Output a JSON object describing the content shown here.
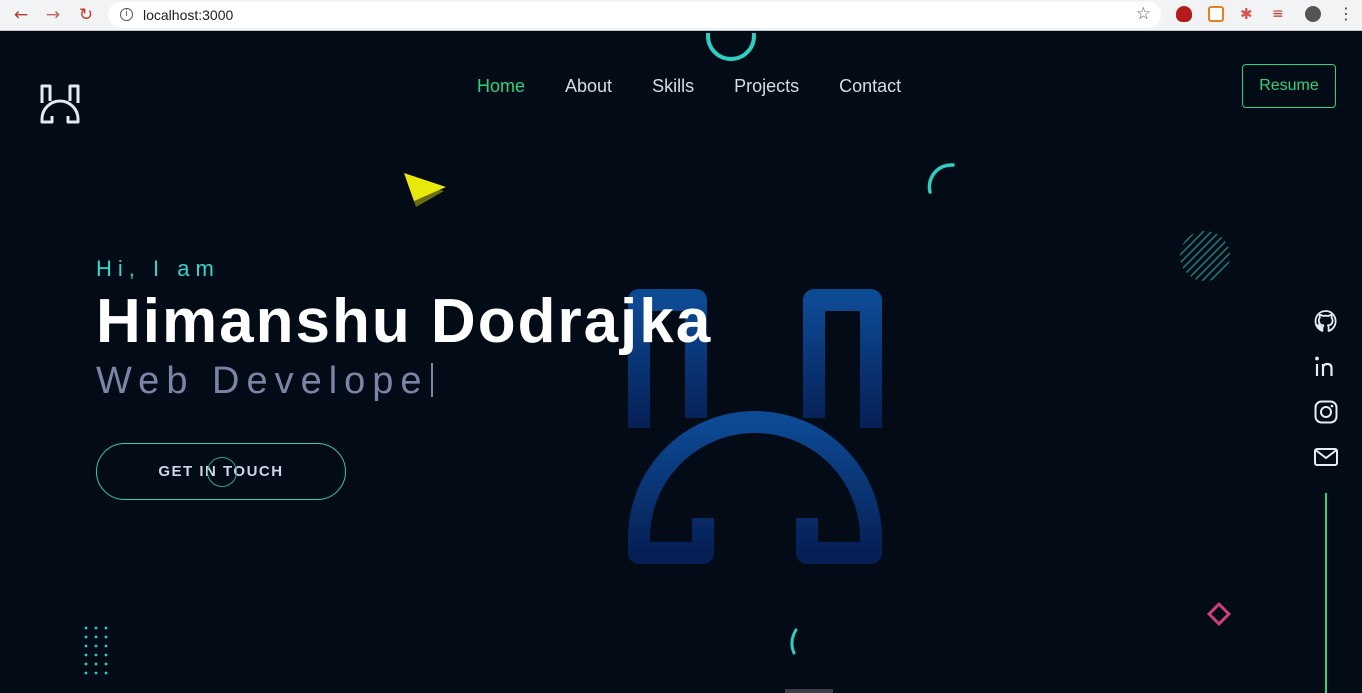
{
  "browser": {
    "url": "localhost:3000",
    "back_icon": "arrow-left-icon",
    "forward_icon": "arrow-right-icon",
    "reload_icon": "reload-icon",
    "bookmark_icon": "star-icon",
    "menu_icon": "kebab-menu-icon"
  },
  "nav": {
    "items": [
      {
        "label": "Home",
        "active": true
      },
      {
        "label": "About",
        "active": false
      },
      {
        "label": "Skills",
        "active": false
      },
      {
        "label": "Projects",
        "active": false
      },
      {
        "label": "Contact",
        "active": false
      }
    ],
    "resume_label": "Resume"
  },
  "hero": {
    "greeting": "Hi, I am",
    "name": "Himanshu Dodrajka",
    "role": "Web Develope",
    "cta_label": "GET IN TOUCH"
  },
  "socials": [
    "github-icon",
    "linkedin-icon",
    "instagram-icon",
    "mail-icon"
  ],
  "colors": {
    "background": "#020b16",
    "accent_green": "#2fd37f",
    "accent_teal": "#33d8c8",
    "role_text": "#7c84a6",
    "monogram_blue": "#0a3a7a"
  }
}
